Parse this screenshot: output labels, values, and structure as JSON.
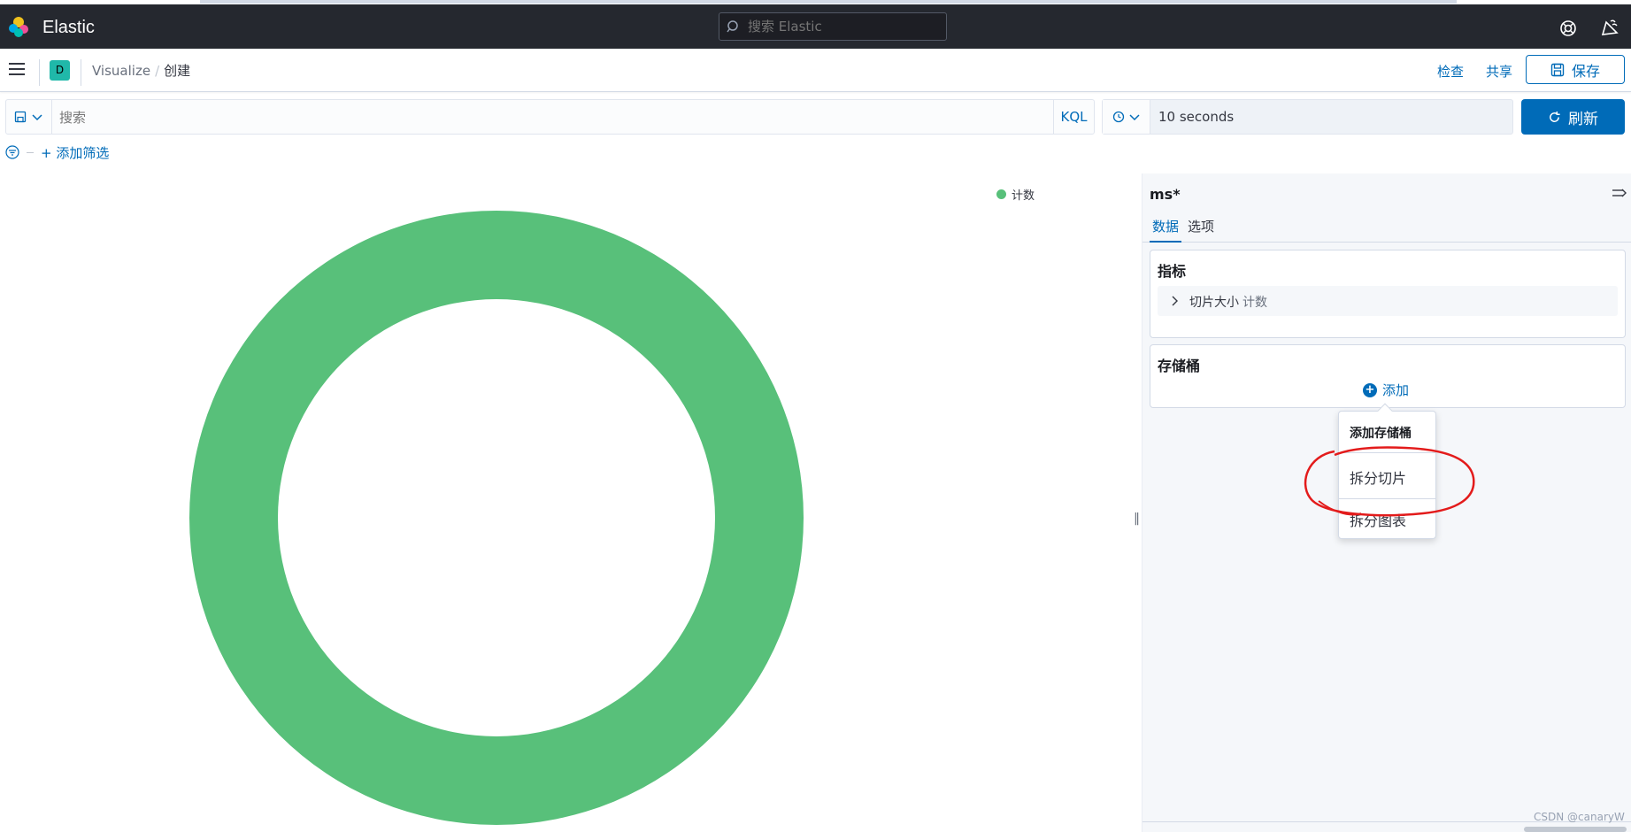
{
  "header": {
    "brand": "Elastic",
    "search_placeholder": "搜索 Elastic",
    "icons": [
      "elastic-logo-icon",
      "search-icon",
      "help-icon",
      "newsfeed-icon"
    ]
  },
  "subbar": {
    "avatar_initial": "D",
    "breadcrumb_1": "Visualize",
    "breadcrumb_2": "创建",
    "inspect": "检查",
    "share": "共享",
    "save": "保存"
  },
  "query": {
    "placeholder": "搜索",
    "language": "KQL",
    "refresh_interval": "10 seconds",
    "refresh": "刷新"
  },
  "filters": {
    "add_filter": "+ 添加筛选"
  },
  "chart_data": {
    "type": "pie",
    "donut": true,
    "categories": [
      "计数"
    ],
    "values": [
      100
    ],
    "legend": "top-right",
    "colors": [
      "#58c07a"
    ]
  },
  "sidebar": {
    "index_pattern": "ms*",
    "tabs": [
      "数据",
      "选项"
    ],
    "metrics_title": "指标",
    "metric_label": "切片大小",
    "metric_agg": "计数",
    "buckets_title": "存储桶",
    "add_label": "添加"
  },
  "popover": {
    "title": "添加存储桶",
    "items": [
      "拆分切片",
      "拆分图表"
    ]
  },
  "watermark": "CSDN @canaryW"
}
